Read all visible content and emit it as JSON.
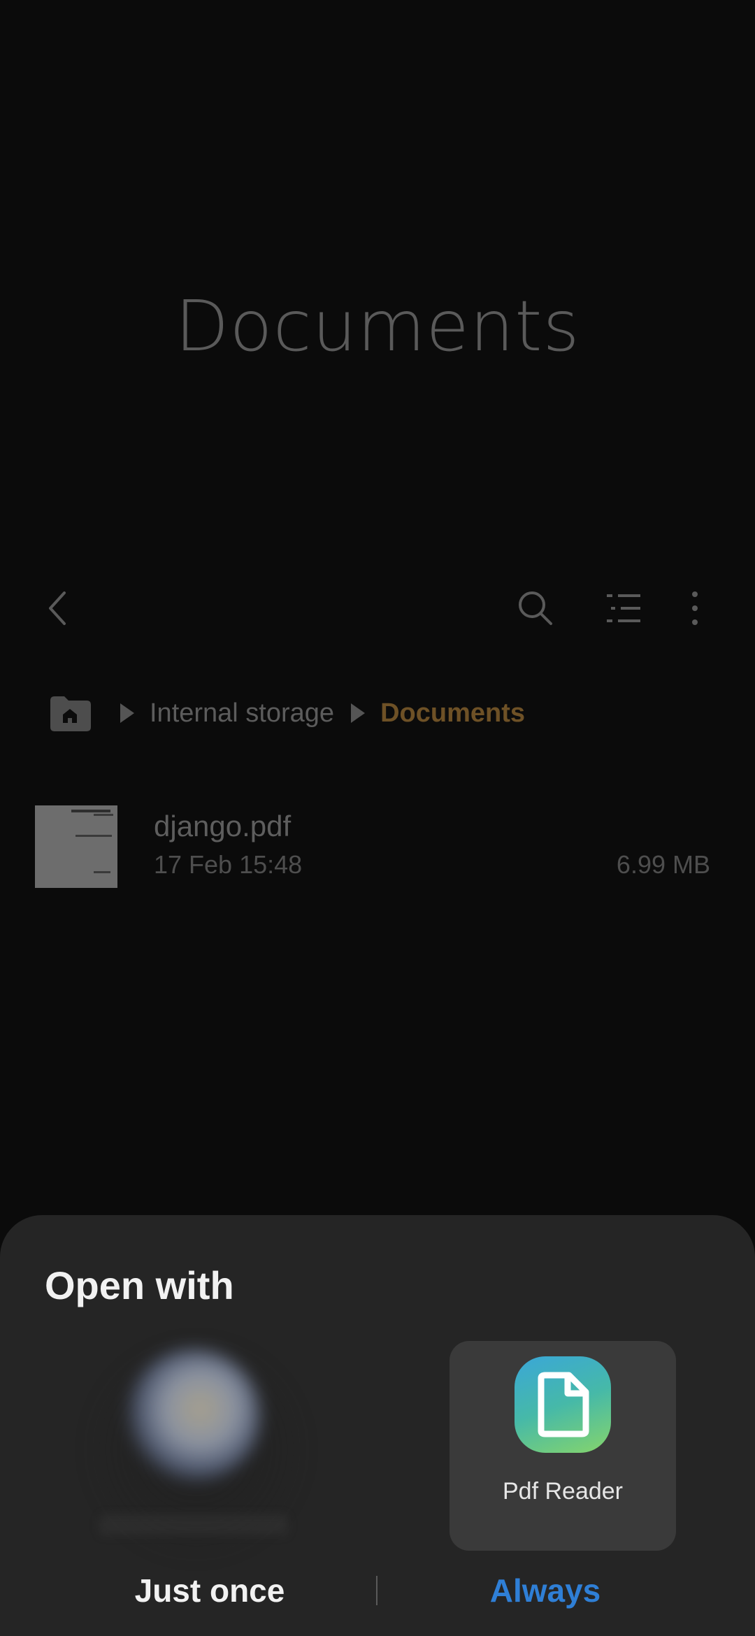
{
  "app": {
    "folder_title": "Documents",
    "breadcrumb": {
      "items": [
        "Internal storage"
      ],
      "current": "Documents"
    },
    "toolbar": {
      "back_icon": "chevron-left-icon",
      "search_icon": "search-icon",
      "list_icon": "list-view-icon",
      "more_icon": "more-vertical-icon"
    },
    "files": [
      {
        "name": "django.pdf",
        "date": "17 Feb 15:48",
        "size": "6.99 MB"
      }
    ]
  },
  "sheet": {
    "title": "Open with",
    "apps": [
      {
        "label": "Pdf Reader",
        "icon": "pdf-reader-app-icon"
      }
    ],
    "buttons": {
      "once": "Just once",
      "always": "Always"
    }
  },
  "colors": {
    "accent_current": "#6e5126",
    "always_blue": "#2f7fd6",
    "sheet_bg": "#252525",
    "selected_bg": "#3a3a3a"
  }
}
